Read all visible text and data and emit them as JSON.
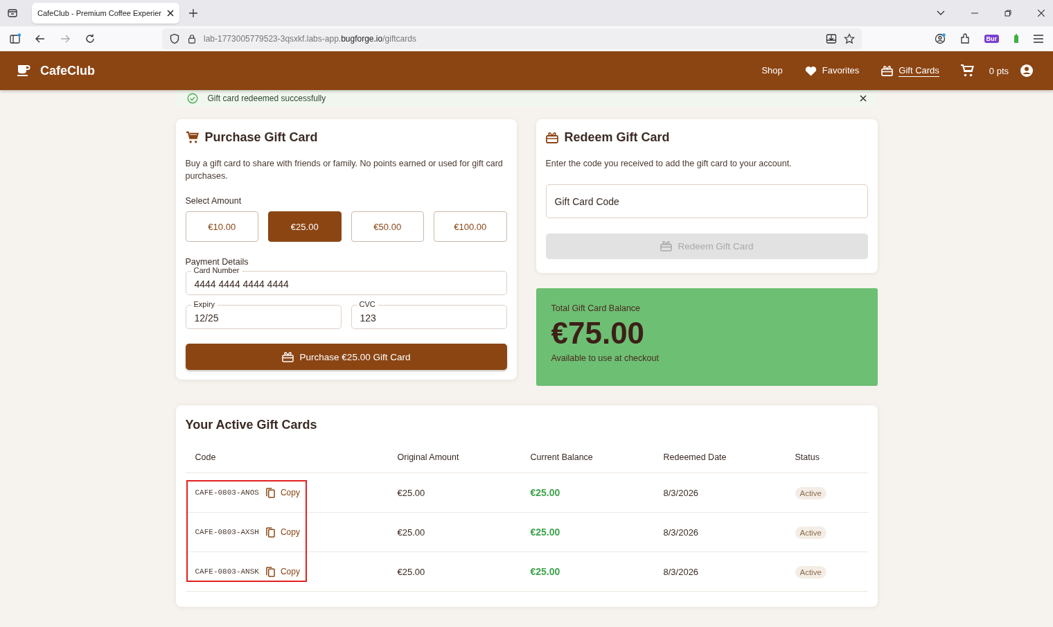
{
  "browser": {
    "tab_title": "CafeClub - Premium Coffee Experier",
    "url_prefix": "lab-1773005779523-3qsxkf.labs-app.",
    "url_domain": "bugforge.io",
    "url_path": "/giftcards",
    "extension_badge": "Bur"
  },
  "header": {
    "brand": "CafeClub",
    "nav": [
      {
        "label": "Shop",
        "kind": "plain",
        "selected": false
      },
      {
        "label": "Favorites",
        "kind": "heart",
        "selected": false
      },
      {
        "label": "Gift Cards",
        "kind": "gift",
        "selected": true
      }
    ],
    "points": "0 pts"
  },
  "toast": {
    "text": "Gift card redeemed successfully"
  },
  "purchase": {
    "title": "Purchase Gift Card",
    "description": "Buy a gift card to share with friends or family. No points earned or used for gift card purchases.",
    "amount_label": "Select Amount",
    "amounts": [
      {
        "label": "€10.00",
        "selected": false
      },
      {
        "label": "€25.00",
        "selected": true
      },
      {
        "label": "€50.00",
        "selected": false
      },
      {
        "label": "€100.00",
        "selected": false
      }
    ],
    "payment_label": "Payment Details",
    "fields": [
      {
        "label": "Card Number",
        "value": "4444 4444 4444 4444"
      },
      {
        "label": "Expiry",
        "value": "12/25"
      },
      {
        "label": "CVC",
        "value": "123"
      }
    ],
    "button": "Purchase €25.00 Gift Card"
  },
  "redeem": {
    "title": "Redeem Gift Card",
    "description": "Enter the code you received to add the gift card to your account.",
    "placeholder": "Gift Card Code",
    "button": "Redeem Gift Card",
    "disabled": true
  },
  "balance": {
    "label": "Total Gift Card Balance",
    "amount": "€75.00",
    "note": "Available to use at checkout"
  },
  "table": {
    "title": "Your Active Gift Cards",
    "code_column_highlighted": true,
    "columns": [
      "Code",
      "Original Amount",
      "Current Balance",
      "Redeemed Date",
      "Status"
    ],
    "rows": [
      {
        "code": "CAFE-0803-ANOS",
        "copy": "Copy",
        "original": "€25.00",
        "balance": "€25.00",
        "date": "8/3/2026",
        "status": "Active"
      },
      {
        "code": "CAFE-0803-AXSH",
        "copy": "Copy",
        "original": "€25.00",
        "balance": "€25.00",
        "date": "8/3/2026",
        "status": "Active"
      },
      {
        "code": "CAFE-0803-ANSK",
        "copy": "Copy",
        "original": "€25.00",
        "balance": "€25.00",
        "date": "8/3/2026",
        "status": "Active"
      }
    ]
  }
}
